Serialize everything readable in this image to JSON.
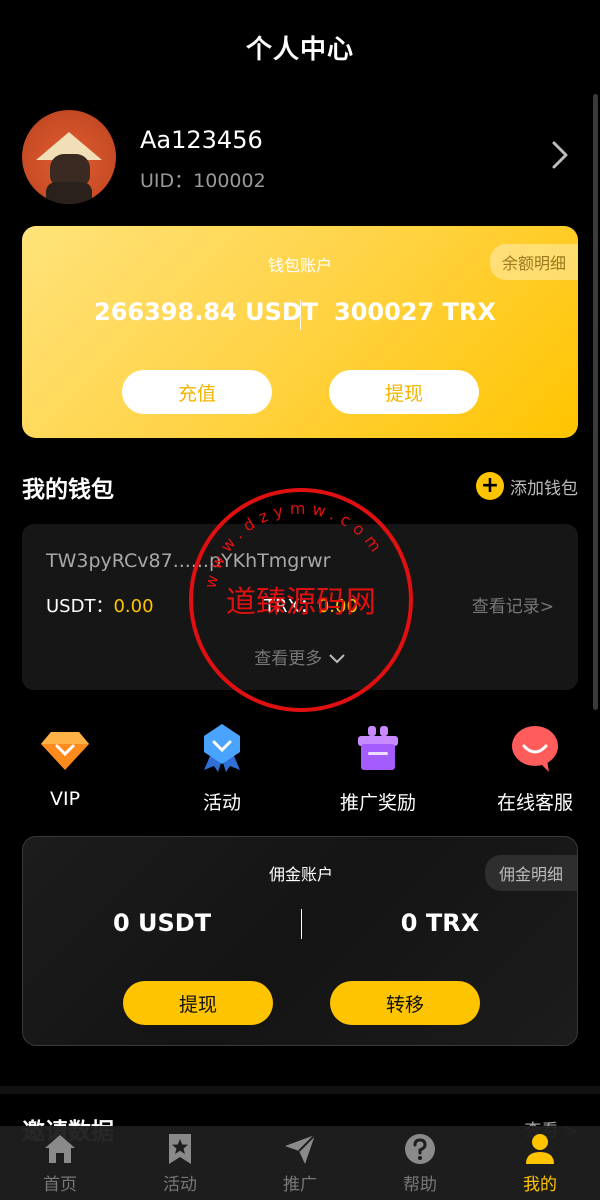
{
  "header": {
    "title": "个人中心"
  },
  "profile": {
    "username": "Aa123456",
    "uid_text": "UID：100002"
  },
  "wallet_account": {
    "title": "钱包账户",
    "detail_label": "余额明细",
    "usdt_balance": "266398.84 USDT",
    "trx_balance": "300027 TRX",
    "recharge_label": "充值",
    "withdraw_label": "提现"
  },
  "my_wallet": {
    "title": "我的钱包",
    "add_label": "添加钱包",
    "item": {
      "address": "TW3pyRCv87......pYKhTmgrwr",
      "usdt_label": "USDT：",
      "usdt_value": "0.00",
      "trx_label": "TRX：",
      "trx_value": "0.00",
      "records_label": "查看记录>",
      "more_label": "查看更多"
    }
  },
  "quick_icons": [
    {
      "label": "VIP",
      "icon": "diamond-icon",
      "color": "#ff8a1e"
    },
    {
      "label": "活动",
      "icon": "badge-icon",
      "color": "#3b8cff"
    },
    {
      "label": "推广奖励",
      "icon": "gift-icon",
      "color": "#a55cff"
    },
    {
      "label": "在线客服",
      "icon": "chat-bubble-icon",
      "color": "#ff5c5c"
    }
  ],
  "commission_account": {
    "title": "佣金账户",
    "detail_label": "佣金明细",
    "usdt_balance": "0 USDT",
    "trx_balance": "0 TRX",
    "withdraw_label": "提现",
    "transfer_label": "转移"
  },
  "next_section": {
    "title": "邀请数据",
    "right_label": "查看 >"
  },
  "tabbar": [
    {
      "label": "首页",
      "icon": "home-icon",
      "active": false
    },
    {
      "label": "活动",
      "icon": "bookmark-star-icon",
      "active": false
    },
    {
      "label": "推广",
      "icon": "paper-plane-icon",
      "active": false
    },
    {
      "label": "帮助",
      "icon": "help-icon",
      "active": false
    },
    {
      "label": "我的",
      "icon": "person-icon",
      "active": true
    }
  ],
  "watermark": {
    "center_text": "道臻源码网",
    "ring_text": "www.dzymw.com"
  },
  "colors": {
    "accent": "#ffc400",
    "background": "#000000",
    "card": "#161616",
    "stamp_red": "#e01010"
  }
}
